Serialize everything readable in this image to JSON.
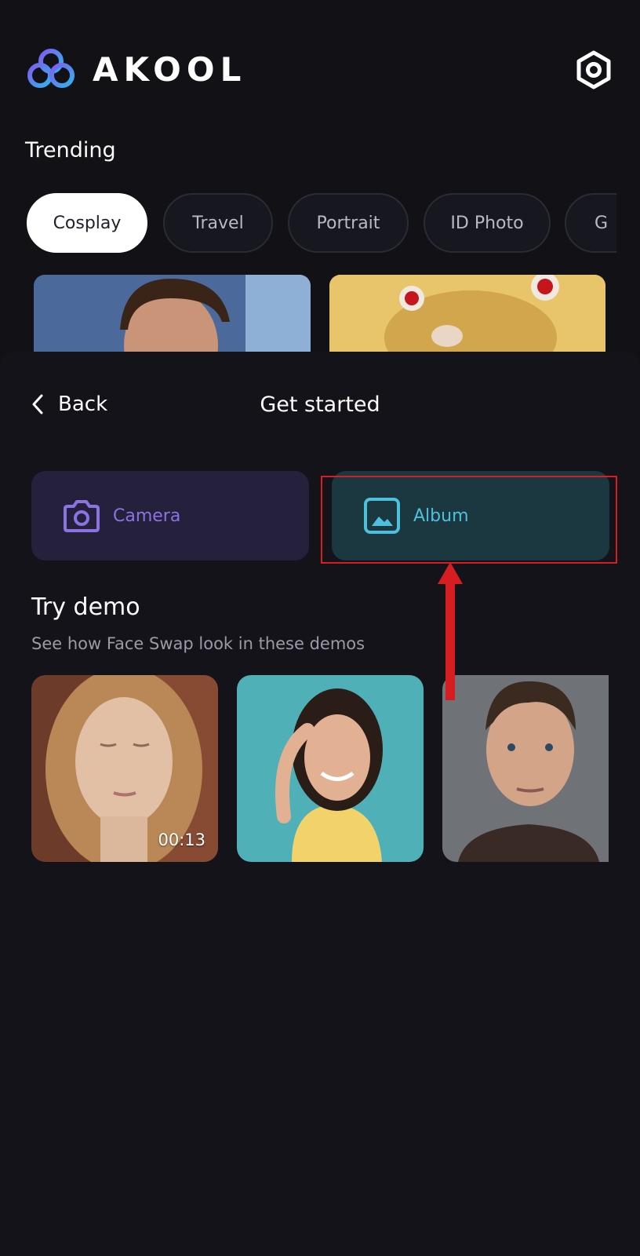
{
  "header": {
    "app_name": "AKOOL",
    "settings_icon": "settings-hexagon-icon"
  },
  "trending": {
    "title": "Trending",
    "categories": [
      {
        "label": "Cosplay",
        "active": true
      },
      {
        "label": "Travel",
        "active": false
      },
      {
        "label": "Portrait",
        "active": false
      },
      {
        "label": "ID Photo",
        "active": false
      },
      {
        "label": "G",
        "active": false
      }
    ]
  },
  "sheet": {
    "back_label": "Back",
    "title": "Get started",
    "sources": [
      {
        "label": "Camera",
        "icon": "camera-icon",
        "color": "#8b73e3"
      },
      {
        "label": "Album",
        "icon": "image-icon",
        "color": "#4dc0dd"
      }
    ],
    "demo": {
      "title": "Try demo",
      "subtitle": "See how Face Swap look in these demos",
      "items": [
        {
          "kind": "video",
          "duration": "00:13"
        },
        {
          "kind": "photo"
        },
        {
          "kind": "photo"
        }
      ]
    }
  },
  "colors": {
    "background": "#111116",
    "annotation": "#d51d22"
  }
}
